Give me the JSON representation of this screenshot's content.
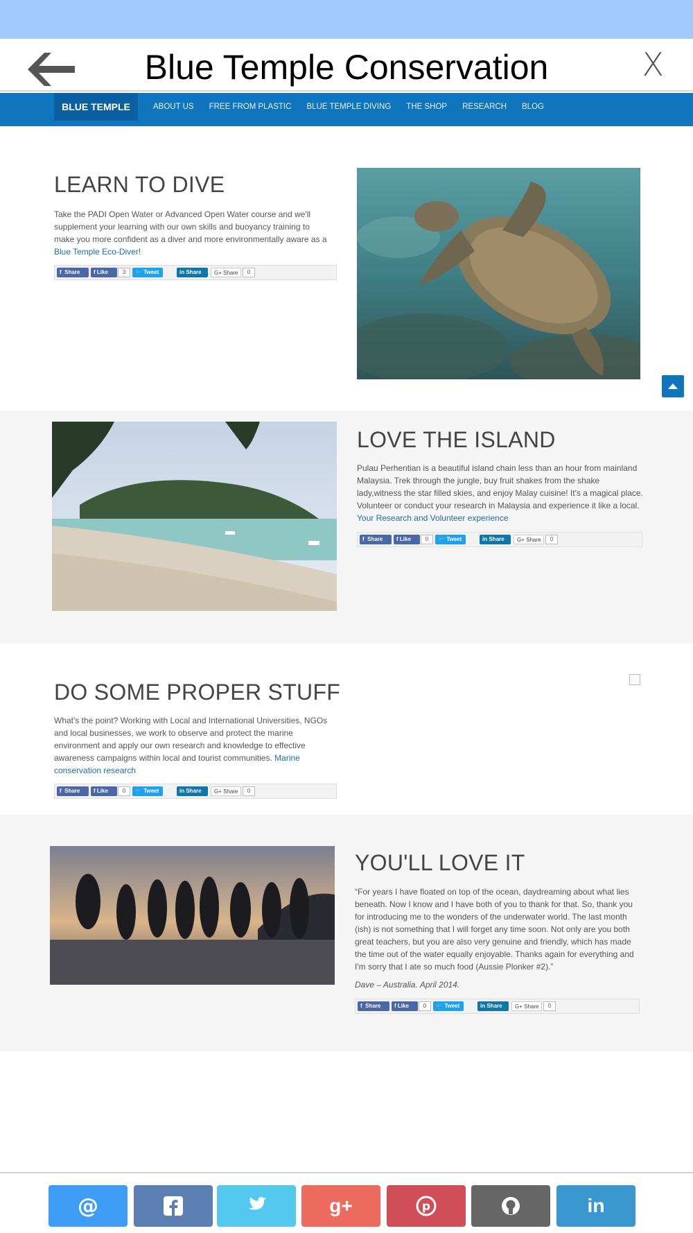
{
  "app": {
    "title": "Blue Temple Conservation",
    "close_label": "X"
  },
  "nav": {
    "brand": "BLUE TEMPLE",
    "links": [
      "ABOUT US",
      "FREE FROM PLASTIC",
      "BLUE TEMPLE DIVING",
      "THE SHOP",
      "RESEARCH",
      "BLOG"
    ]
  },
  "sections": [
    {
      "title": "LEARN TO DIVE",
      "text": "Take the PADI Open Water or Advanced Open Water course and we'll supplement your learning with our own skills and buoyancy training to make you more confident as a diver and more environmentally aware as a ",
      "link": "Blue Temple Eco-Diver!",
      "like_count": "3",
      "gplus_count": "0"
    },
    {
      "title": "LOVE THE ISLAND",
      "text": "Pulau Perhentian is a beautiful island chain less than an hour from mainland Malaysia. Trek through the jungle, buy fruit shakes from the shake lady,witness the star filled skies, and enjoy Malay cuisine! It's a magical place. Volunteer or conduct your research in Malaysia and experience it like a local.",
      "link": "Your Research and Volunteer experience",
      "like_count": "0",
      "gplus_count": "0"
    },
    {
      "title": "DO SOME PROPER STUFF",
      "text": "What's the point? Working with Local and International Universities, NGOs and local businesses, we work to observe and protect the marine environment and apply our own research and knowledge to effective awareness campaigns within local and tourist communities. ",
      "link": "Marine conservation research",
      "like_count": "0",
      "gplus_count": "0"
    },
    {
      "title": "YOU'LL LOVE IT",
      "text": "“For years I have floated on top of the ocean, daydreaming about what lies beneath. Now I know and I have both of you to thank for that. So, thank you for introducing me to the wonders of the underwater world. The last month (ish) is not something that I will forget any time soon. Not only are you both great teachers, but you are also very genuine and friendly, which has made the time out of the water equally enjoyable. Thanks again for everything and I'm sorry that I ate so much food (Aussie Plonker #2).”",
      "signature": "Dave – Australia. April 2014.",
      "like_count": "0",
      "gplus_count": "0"
    }
  ],
  "share_labels": {
    "facebook": "Share",
    "like": "Like",
    "tweet": "Tweet",
    "linkedin": "Share",
    "gplus": "Share"
  },
  "share_buttons": [
    {
      "name": "email",
      "icon": "at-icon",
      "color": "#3d9df5"
    },
    {
      "name": "facebook",
      "icon": "facebook-icon",
      "color": "#5b7fb2"
    },
    {
      "name": "twitter",
      "icon": "twitter-icon",
      "color": "#55c8f0"
    },
    {
      "name": "google-plus",
      "icon": "google-plus-icon",
      "color": "#ec6b5e"
    },
    {
      "name": "pinterest",
      "icon": "pinterest-icon",
      "color": "#cf4e58"
    },
    {
      "name": "github",
      "icon": "github-icon",
      "color": "#666666"
    },
    {
      "name": "linkedin",
      "icon": "linkedin-icon",
      "color": "#3a97cf"
    }
  ],
  "colors": {
    "top_band": "#a3cbfc",
    "nav_bg": "#0f75bc",
    "brand_bg": "#0c5fa0",
    "link": "#1b6fb3"
  }
}
